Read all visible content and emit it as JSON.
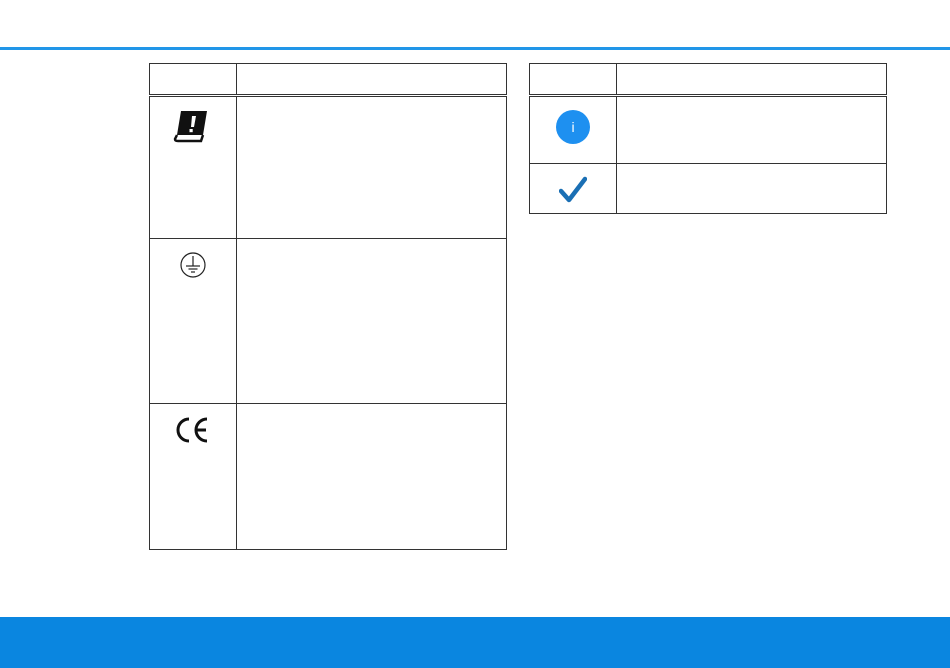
{
  "colors": {
    "accent": "#2196e8",
    "footer": "#0a86e0",
    "info": "#1e90f0",
    "check": "#1a6fb4"
  },
  "left_table": {
    "header": {
      "symbol": "",
      "description": ""
    },
    "rows": [
      {
        "icon": "manual-warning-icon",
        "description": ""
      },
      {
        "icon": "protective-earth-icon",
        "description": ""
      },
      {
        "icon": "ce-mark-icon",
        "description": ""
      }
    ]
  },
  "right_table": {
    "header": {
      "symbol": "",
      "description": ""
    },
    "rows": [
      {
        "icon": "info-icon",
        "icon_text": "i",
        "description": ""
      },
      {
        "icon": "checkmark-icon",
        "description": ""
      }
    ]
  }
}
